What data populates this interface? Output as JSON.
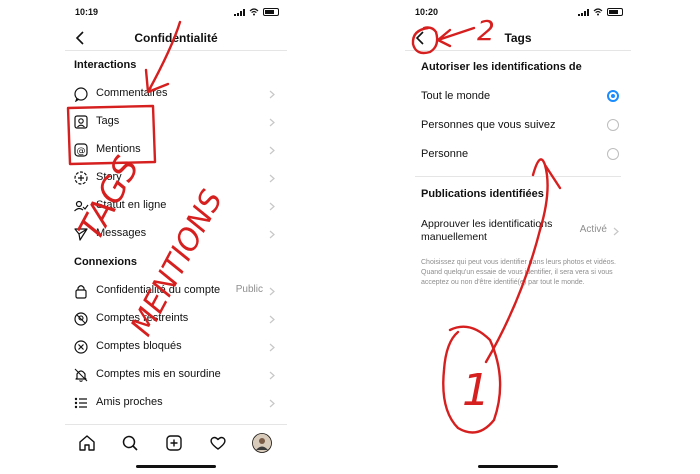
{
  "left_screen": {
    "status_time": "10:19",
    "nav_title": "Confidentialité",
    "section_interactions": "Interactions",
    "interactions": [
      {
        "label": "Commentaires",
        "icon": "comment-icon"
      },
      {
        "label": "Tags",
        "icon": "tag-person-icon"
      },
      {
        "label": "Mentions",
        "icon": "at-icon"
      },
      {
        "label": "Story",
        "icon": "story-plus-icon"
      },
      {
        "label": "Statut en ligne",
        "icon": "activity-status-icon"
      },
      {
        "label": "Messages",
        "icon": "paper-plane-icon"
      }
    ],
    "section_connexions": "Connexions",
    "connexions": [
      {
        "label": "Confidentialité du compte",
        "value": "Public",
        "icon": "lock-icon"
      },
      {
        "label": "Comptes restreints",
        "icon": "restricted-icon"
      },
      {
        "label": "Comptes bloqués",
        "icon": "blocked-icon"
      },
      {
        "label": "Comptes mis en sourdine",
        "icon": "muted-bell-icon"
      },
      {
        "label": "Amis proches",
        "icon": "list-icon"
      }
    ],
    "tabbar": [
      "home-icon",
      "search-icon",
      "add-post-icon",
      "heart-icon",
      "profile-avatar"
    ]
  },
  "right_screen": {
    "status_time": "10:20",
    "nav_title": "Tags",
    "section_allow": "Autoriser les identifications de",
    "options": [
      {
        "label": "Tout le monde",
        "selected": true
      },
      {
        "label": "Personnes que vous suivez",
        "selected": false
      },
      {
        "label": "Personne",
        "selected": false
      }
    ],
    "section_tagged": "Publications identifiées",
    "approve_label": "Approuver les identifications manuellement",
    "approve_value": "Activé",
    "note": "Choisissez qui peut vous identifier dans leurs photos et vidéos. Quand quelqu'un essaie de vous identifier, il sera vera si vous acceptez ou non d'être identifié(e) par tout le monde."
  },
  "annotations": {
    "color": "#d61f1f",
    "text_tags": "TAGS",
    "text_mentions": "MENTIONS",
    "text_two": "2",
    "text_one": "1"
  }
}
